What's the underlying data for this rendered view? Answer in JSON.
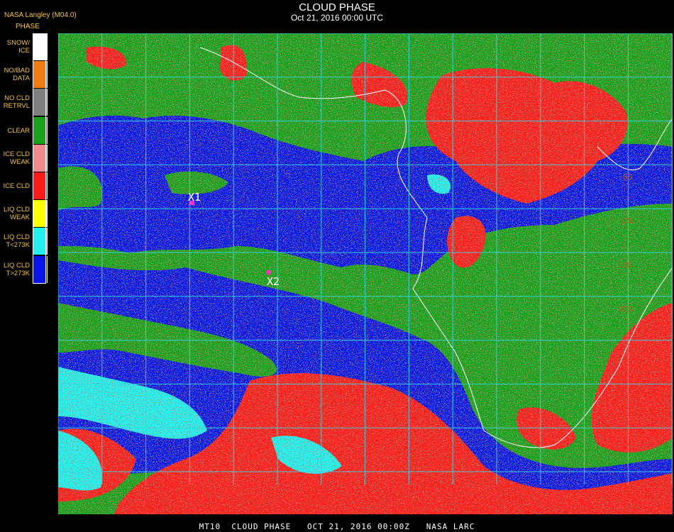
{
  "header": {
    "title": "CLOUD PHASE",
    "subtitle": "Oct 21, 2016 00:00 UTC"
  },
  "credit": "NASA Langley (M04.0)",
  "legend": {
    "title": "PHASE",
    "items": [
      {
        "label": "SNOW/\nICE",
        "color": "#ffffff"
      },
      {
        "label": "NO/BAD\nDATA",
        "color": "#f07c12"
      },
      {
        "label": "NO CLD\nRETRVL",
        "color": "#808080"
      },
      {
        "label": "CLEAR",
        "color": "#1aa01a"
      },
      {
        "label": "ICE CLD\nWEAK",
        "color": "#f08c8c"
      },
      {
        "label": "ICE CLD",
        "color": "#ff1a1a"
      },
      {
        "label": "LIQ CLD\nWEAK",
        "color": "#ffff00"
      },
      {
        "label": "LIQ CLD\nT<273K",
        "color": "#22f0f0"
      },
      {
        "label": "LIQ CLD\nT>273K",
        "color": "#0a14e6"
      }
    ]
  },
  "markers": [
    {
      "label": "X1"
    },
    {
      "label": "X2"
    }
  ],
  "lat_labels": [
    "5S",
    "10S",
    "15S",
    "20S"
  ],
  "colors": {
    "grid": "#3ad6e0",
    "coast": "#ffffff",
    "clear": "#1aa01a",
    "ice": "#ff1a1a",
    "liq_warm": "#0a14e6",
    "liq_cold": "#22f0f0",
    "marker": "#ff2cc8"
  },
  "footer": "MT10  CLOUD PHASE   OCT 21, 2016 00:00Z   NASA LARC"
}
